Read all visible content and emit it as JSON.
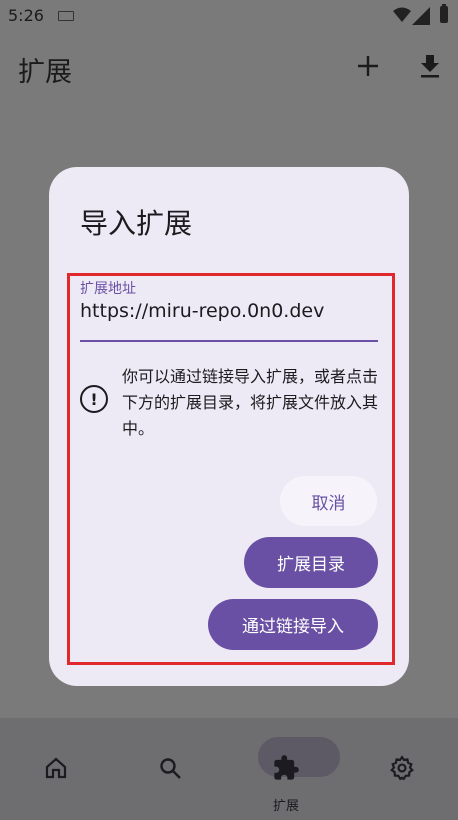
{
  "status_bar": {
    "time": "5:26"
  },
  "app_bar": {
    "title": "扩展"
  },
  "dialog": {
    "title": "导入扩展",
    "field_label": "扩展地址",
    "field_value": "https://miru-repo.0n0.dev",
    "info_text": "你可以通过链接导入扩展，或者点击下方的扩展目录，将扩展文件放入其中。",
    "cancel_label": "取消",
    "catalog_label": "扩展目录",
    "import_label": "通过链接导入"
  },
  "bottom_nav": {
    "items": [
      {
        "icon": "home-icon",
        "label": ""
      },
      {
        "icon": "search-icon",
        "label": ""
      },
      {
        "icon": "extension-icon",
        "label": "扩展"
      },
      {
        "icon": "settings-icon",
        "label": ""
      }
    ],
    "active_index": 2
  }
}
